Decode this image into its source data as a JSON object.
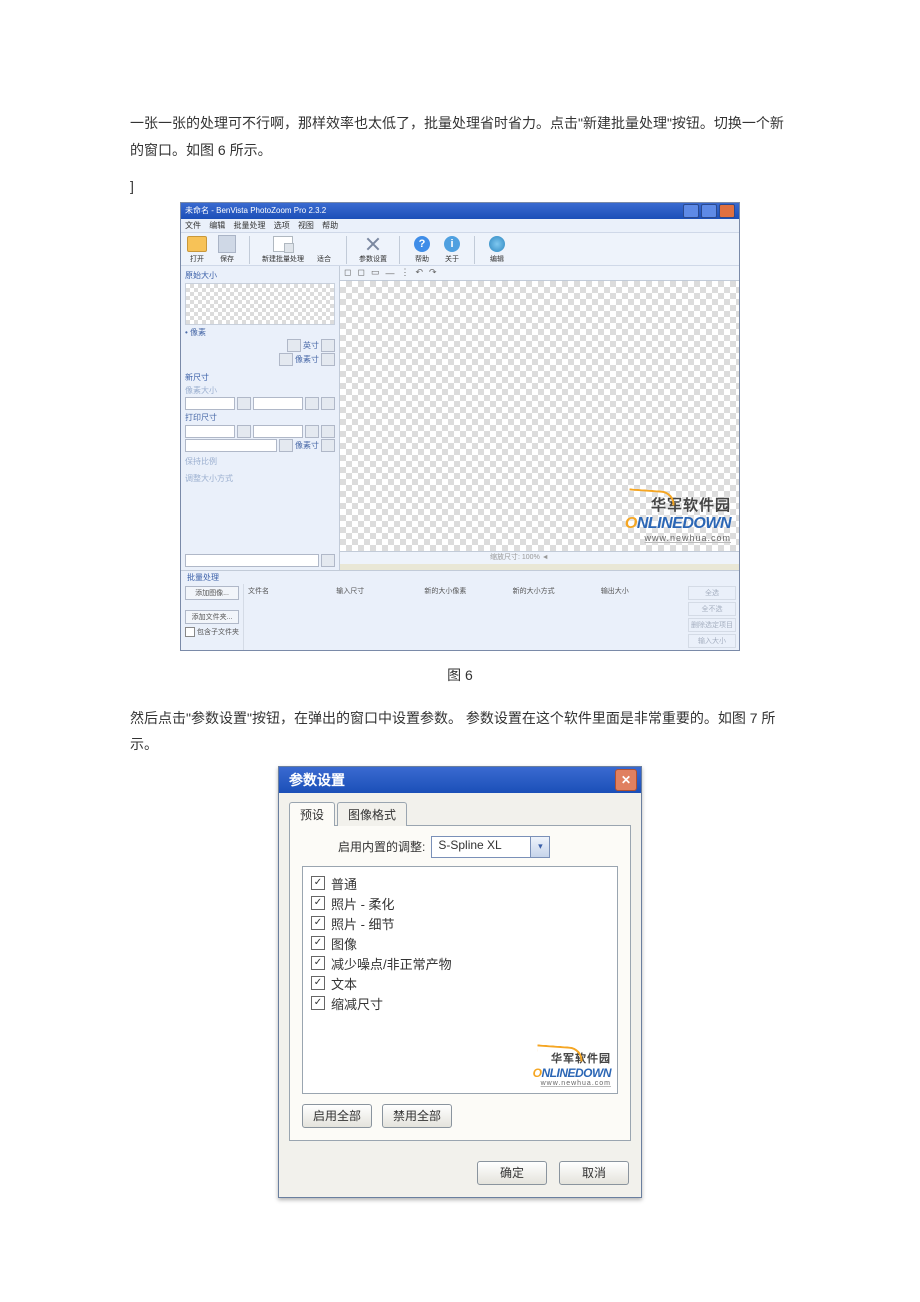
{
  "doc": {
    "para1": "一张一张的处理可不行啊，那样效率也太低了，批量处理省时省力。点击\"新建批量处理\"按钮。切换一个新的窗口。如图 6 所示。",
    "bracket": "]",
    "caption6": "图 6",
    "para2": "然后点击\"参数设置\"按钮，在弹出的窗口中设置参数。 参数设置在这个软件里面是非常重要的。如图 7 所示。"
  },
  "fig6": {
    "title": "未命名 - BenVista PhotoZoom Pro 2.3.2",
    "menus": {
      "m1": "文件",
      "m2": "编辑",
      "m3": "批量处理",
      "m4": "选项",
      "m5": "视图",
      "m6": "帮助"
    },
    "toolbar": {
      "open": "打开",
      "save": "保存",
      "batch": "新建批量处理",
      "fit": "适合",
      "pref": "参数设置",
      "help": "帮助",
      "about": "关于",
      "web": "编辑"
    },
    "left": {
      "sect_orig": "原始大小",
      "pixel_label": "• 像素",
      "unit1": "英寸",
      "unit2": "像素寸",
      "sect_new": "新尺寸",
      "pixel_size": "像素大小",
      "print_size": "打印尺寸",
      "keep_ratio": "保持比例",
      "resize_method": "调整大小方式"
    },
    "status": "缩放尺寸: 100% ◄",
    "batch": {
      "title": "批量处理",
      "btn_add_img": "添加图像...",
      "btn_add_folder": "添加文件夹...",
      "chk_subfolder": "包含子文件夹",
      "col_file": "文件名",
      "col_input": "输入尺寸",
      "col_new_px": "新的大小像素",
      "col_new_method": "新的大小方式",
      "col_out": "输出大小",
      "r1": "全选",
      "r2": "全不选",
      "r3": "删除选定项目",
      "r4": "输入大小"
    }
  },
  "watermark": {
    "cn": "华军软件园",
    "en_o": "O",
    "en_rest": "NLINEDOWN",
    "url": "www.newhua.com"
  },
  "fig7": {
    "title": "参数设置",
    "tab_presets": "预设",
    "tab_format": "图像格式",
    "label_enable": "启用内置的调整:",
    "combo_value": "S-Spline XL",
    "items": {
      "i1": "普通",
      "i2": "照片 - 柔化",
      "i3": "照片 - 细节",
      "i4": "图像",
      "i5": "减少噪点/非正常产物",
      "i6": "文本",
      "i7": "缩减尺寸"
    },
    "btn_enable_all": "启用全部",
    "btn_disable_all": "禁用全部",
    "btn_ok": "确定",
    "btn_cancel": "取消"
  }
}
